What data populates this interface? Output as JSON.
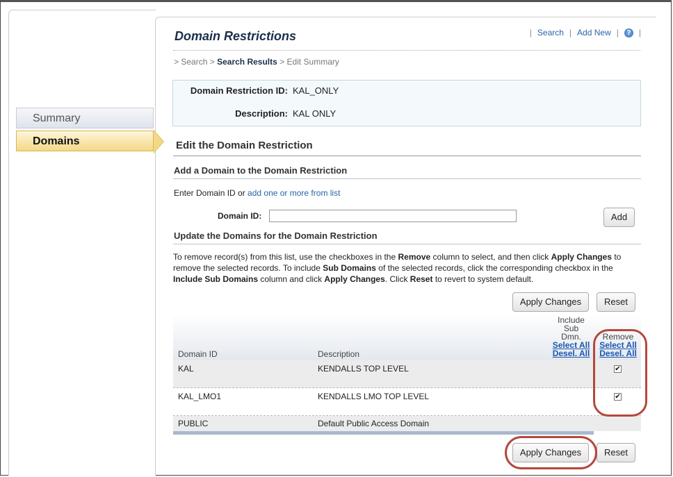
{
  "nav": {
    "items": [
      {
        "label": "Summary"
      },
      {
        "label": "Domains"
      }
    ]
  },
  "header": {
    "title": "Domain Restrictions",
    "links": {
      "search": "Search",
      "add_new": "Add New",
      "help_icon": "?"
    }
  },
  "breadcrumb": {
    "prefix": ">",
    "search": "Search",
    "sep1": ">",
    "results": "Search Results",
    "sep2": ">",
    "current": "Edit Summary"
  },
  "info": {
    "id_label": "Domain Restriction ID:",
    "id_value": "KAL_ONLY",
    "desc_label": "Description:",
    "desc_value": "KAL ONLY"
  },
  "edit": {
    "heading": "Edit the Domain Restriction",
    "add_heading": "Add a Domain to the Domain Restriction",
    "enter_prefix": "Enter Domain ID or",
    "enter_link": "add one or more from list",
    "domain_label": "Domain ID:",
    "domain_value": "",
    "add_button": "Add",
    "update_heading": "Update the Domains for the Domain Restriction",
    "instr": {
      "p1": "To remove record(s) from this list, use the checkboxes in the",
      "b1": "Remove",
      "p2": "column to select, and then click",
      "b2": "Apply Changes",
      "p3": "to remove the selected records. To include",
      "b3": "Sub Domains",
      "p4": "of the selected records, click the corresponding checkbox in the",
      "b4": "Include Sub Domains",
      "p5": "column and click",
      "b5": "Apply Changes",
      "p6": ". Click",
      "b6": "Reset",
      "p7": "to revert to system default."
    }
  },
  "buttons": {
    "apply": "Apply Changes",
    "reset": "Reset"
  },
  "table": {
    "col_domain": "Domain ID",
    "col_desc": "Description",
    "col_include_l1": "Include",
    "col_include_l2": "Sub",
    "col_include_l3": "Dmn.",
    "col_remove": "Remove",
    "select_all": "Select All",
    "desel_all": "Desel. All",
    "rows": [
      {
        "id": "KAL",
        "desc": "KENDALLS TOP LEVEL",
        "remove": true
      },
      {
        "id": "KAL_LMO1",
        "desc": "KENDALLS LMO TOP LEVEL",
        "remove": true
      },
      {
        "id": "PUBLIC",
        "desc": "Default Public Access Domain",
        "remove": null
      }
    ]
  },
  "colors": {
    "highlight": "#b5473a",
    "link": "#2a63a8",
    "nav_active": "#f3d886"
  }
}
